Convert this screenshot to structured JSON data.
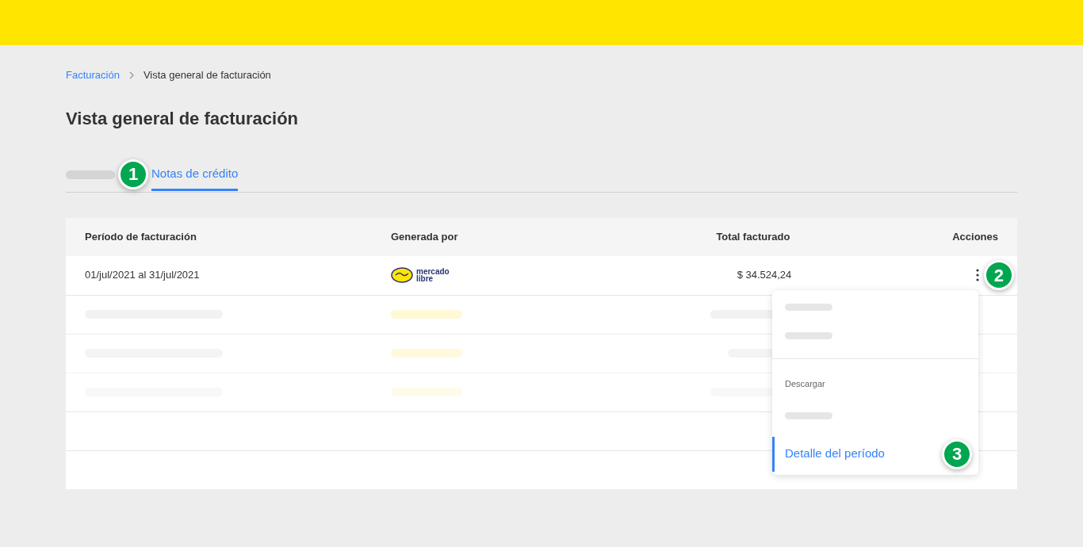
{
  "breadcrumb": [
    {
      "label": "Facturación",
      "link": true
    },
    {
      "label": "Vista general de facturación",
      "link": false
    }
  ],
  "title": "Vista general de facturación",
  "tabs": [
    {
      "kind": "skeleton",
      "selected": false
    },
    {
      "kind": "label",
      "label": "Notas de crédito",
      "selected": true,
      "callout": "1"
    }
  ],
  "table": {
    "columns": [
      "Período de facturación",
      "Generada por",
      "Total facturado",
      "Acciones"
    ],
    "rows": [
      {
        "kind": "data",
        "period": "01/jul/2021 al 31/jul/2021",
        "logo_text": [
          "mercado",
          "libre"
        ],
        "total": "$ 34.524,24",
        "callout": "2"
      },
      {
        "kind": "skeleton"
      },
      {
        "kind": "skeleton"
      },
      {
        "kind": "skeleton"
      },
      {
        "kind": "empty"
      },
      {
        "kind": "empty"
      }
    ]
  },
  "menu": {
    "items": [
      {
        "kind": "skeleton"
      },
      {
        "kind": "skeleton"
      },
      {
        "kind": "divider"
      },
      {
        "kind": "heading",
        "label": "Descargar"
      },
      {
        "kind": "skeleton"
      },
      {
        "kind": "item",
        "label": "Detalle del período",
        "selected": true,
        "callout": "3"
      }
    ]
  }
}
